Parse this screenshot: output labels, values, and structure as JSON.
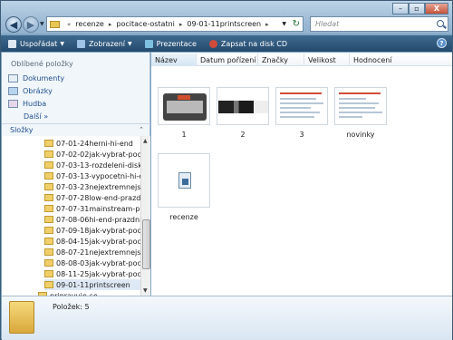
{
  "window": {
    "controls": {
      "minimize": "–",
      "maximize": "▫",
      "close": "X"
    }
  },
  "address": {
    "crumbs": [
      "recenze",
      "pocitace-ostatni",
      "09-01-11printscreen"
    ]
  },
  "search": {
    "placeholder": "Hledat"
  },
  "toolbar": {
    "organize": "Uspořádat",
    "views": "Zobrazení",
    "slideshow": "Prezentace",
    "burn": "Zapsat na disk CD",
    "help": "?"
  },
  "favorites": {
    "title": "Oblíbené položky",
    "items": [
      "Dokumenty",
      "Obrázky",
      "Hudba"
    ],
    "more": "Další  »"
  },
  "folders": {
    "title": "Složky",
    "items": [
      "07-01-24herni-hi-end",
      "07-02-02jak-vybrat-poc",
      "07-03-13-rozdeleni-disk",
      "07-03-13-vypocetni-hi-e",
      "07-03-23nejextremnejsi-",
      "07-07-28low-end-prazd",
      "07-07-31mainstream-pr",
      "07-08-06hi-end-prazdni",
      "07-09-18jak-vybrat-poc",
      "08-04-15jak-vybrat-poc",
      "08-07-21nejextremnejsi-",
      "08-08-03jak-vybrat-poc",
      "08-11-25jak-vybrat-poc",
      "09-01-11printscreen",
      "pripravuje-se"
    ]
  },
  "columns": [
    "Název",
    "Datum pořízení",
    "Značky",
    "Velikost",
    "Hodnocení"
  ],
  "files": [
    "1",
    "2",
    "3",
    "novinky",
    "recenze"
  ],
  "status": {
    "count": "Položek: 5"
  }
}
